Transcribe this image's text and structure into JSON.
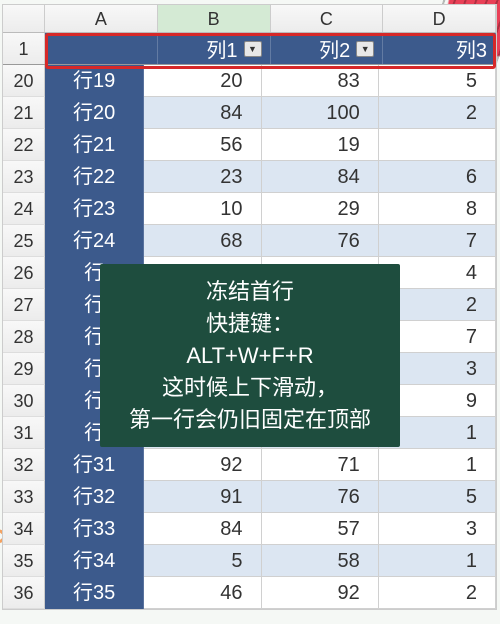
{
  "columnLetters": [
    "A",
    "B",
    "C",
    "D"
  ],
  "selectedCol": 1,
  "frozenHeader": {
    "rowNum": "1",
    "cells": [
      {
        "label": "",
        "filter": false
      },
      {
        "label": "列1",
        "filter": true
      },
      {
        "label": "列2",
        "filter": true
      },
      {
        "label": "列3",
        "filter": false
      }
    ]
  },
  "rows": [
    {
      "num": "20",
      "label": "行19",
      "v1": "20",
      "v2": "83",
      "v3": "5"
    },
    {
      "num": "21",
      "label": "行20",
      "v1": "84",
      "v2": "100",
      "v3": "2"
    },
    {
      "num": "22",
      "label": "行21",
      "v1": "56",
      "v2": "19",
      "v3": ""
    },
    {
      "num": "23",
      "label": "行22",
      "v1": "23",
      "v2": "84",
      "v3": "6"
    },
    {
      "num": "24",
      "label": "行23",
      "v1": "10",
      "v2": "29",
      "v3": "8"
    },
    {
      "num": "25",
      "label": "行24",
      "v1": "68",
      "v2": "76",
      "v3": "7"
    },
    {
      "num": "26",
      "label": "行",
      "v1": "",
      "v2": "",
      "v3": "4"
    },
    {
      "num": "27",
      "label": "行",
      "v1": "",
      "v2": "",
      "v3": "2"
    },
    {
      "num": "28",
      "label": "行",
      "v1": "",
      "v2": "",
      "v3": "7"
    },
    {
      "num": "29",
      "label": "行",
      "v1": "",
      "v2": "",
      "v3": "3"
    },
    {
      "num": "30",
      "label": "行",
      "v1": "",
      "v2": "",
      "v3": "9"
    },
    {
      "num": "31",
      "label": "行",
      "v1": "",
      "v2": "",
      "v3": "1"
    },
    {
      "num": "32",
      "label": "行31",
      "v1": "92",
      "v2": "71",
      "v3": "1"
    },
    {
      "num": "33",
      "label": "行32",
      "v1": "91",
      "v2": "76",
      "v3": "5"
    },
    {
      "num": "34",
      "label": "行33",
      "v1": "84",
      "v2": "57",
      "v3": "3"
    },
    {
      "num": "35",
      "label": "行34",
      "v1": "5",
      "v2": "58",
      "v3": "1"
    },
    {
      "num": "36",
      "label": "行35",
      "v1": "46",
      "v2": "92",
      "v3": "2"
    }
  ],
  "overlay": {
    "line1": "冻结首行",
    "line2": "快捷键：",
    "line3": "ALT+W+F+R",
    "line4": "这时候上下滑动，",
    "line5": "第一行会仍旧固定在顶部"
  },
  "filterGlyph": "▼"
}
